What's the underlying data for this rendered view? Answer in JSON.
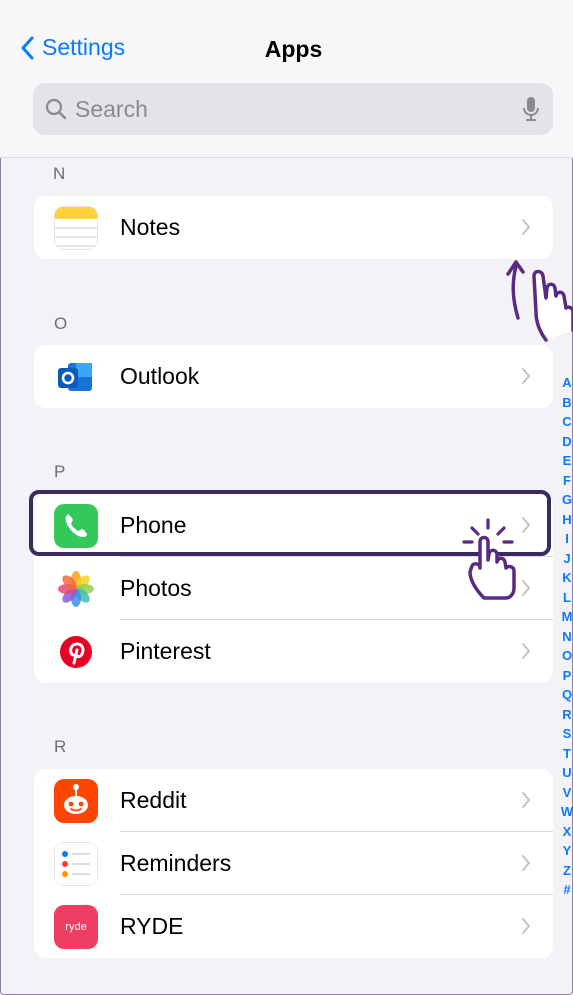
{
  "nav": {
    "back_label": "Settings",
    "title": "Apps"
  },
  "search": {
    "placeholder": "Search"
  },
  "sections": [
    {
      "header": "N",
      "items": [
        {
          "label": "Notes",
          "icon": "notes-icon"
        }
      ]
    },
    {
      "header": "O",
      "items": [
        {
          "label": "Outlook",
          "icon": "outlook-icon"
        }
      ]
    },
    {
      "header": "P",
      "items": [
        {
          "label": "Phone",
          "icon": "phone-icon"
        },
        {
          "label": "Photos",
          "icon": "photos-icon"
        },
        {
          "label": "Pinterest",
          "icon": "pinterest-icon"
        }
      ]
    },
    {
      "header": "R",
      "items": [
        {
          "label": "Reddit",
          "icon": "reddit-icon"
        },
        {
          "label": "Reminders",
          "icon": "reminders-icon"
        },
        {
          "label": "RYDE",
          "icon": "ryde-icon",
          "icon_text": "ryde"
        }
      ]
    }
  ],
  "index_letters": [
    "A",
    "B",
    "C",
    "D",
    "E",
    "F",
    "G",
    "H",
    "I",
    "J",
    "K",
    "L",
    "M",
    "N",
    "O",
    "P",
    "Q",
    "R",
    "S",
    "T",
    "U",
    "V",
    "W",
    "X",
    "Y",
    "Z",
    "#"
  ],
  "colors": {
    "accent": "#0a7aff",
    "highlight_border": "#3b2a5e",
    "annotation": "#5a2a82"
  }
}
